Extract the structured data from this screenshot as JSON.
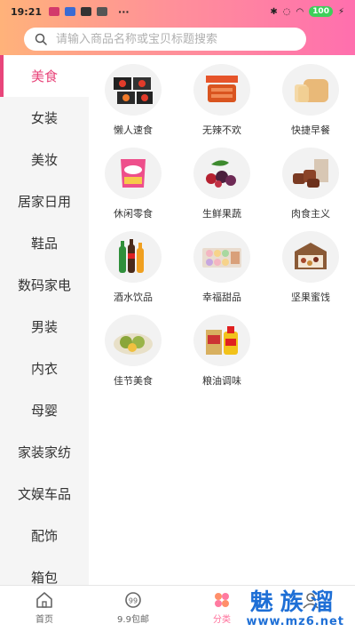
{
  "status_bar": {
    "time": "19:21",
    "dots": "···",
    "battery": "100"
  },
  "search": {
    "placeholder": "请输入商品名称或宝贝标题搜索"
  },
  "sidebar": {
    "items": [
      {
        "label": "美食",
        "active": true
      },
      {
        "label": "女装"
      },
      {
        "label": "美妆"
      },
      {
        "label": "居家日用"
      },
      {
        "label": "鞋品"
      },
      {
        "label": "数码家电"
      },
      {
        "label": "男装"
      },
      {
        "label": "内衣"
      },
      {
        "label": "母婴"
      },
      {
        "label": "家装家纺"
      },
      {
        "label": "文娱车品"
      },
      {
        "label": "配饰"
      },
      {
        "label": "箱包"
      }
    ]
  },
  "categories": [
    {
      "label": "懒人速食",
      "icon": "instant-noodles-icon"
    },
    {
      "label": "无辣不欢",
      "icon": "spicy-snack-icon"
    },
    {
      "label": "快捷早餐",
      "icon": "bread-icon"
    },
    {
      "label": "休闲零食",
      "icon": "snack-bag-icon"
    },
    {
      "label": "生鲜果蔬",
      "icon": "fruit-icon"
    },
    {
      "label": "肉食主义",
      "icon": "meat-icon"
    },
    {
      "label": "酒水饮品",
      "icon": "drinks-icon"
    },
    {
      "label": "幸福甜品",
      "icon": "macaron-icon"
    },
    {
      "label": "坚果蜜饯",
      "icon": "nuts-icon"
    },
    {
      "label": "佳节美食",
      "icon": "festival-food-icon"
    },
    {
      "label": "粮油调味",
      "icon": "cooking-oil-icon"
    }
  ],
  "bottom_nav": [
    {
      "label": "首页",
      "icon": "home-icon"
    },
    {
      "label": "9.9包邮",
      "icon": "nine-nine-icon"
    },
    {
      "label": "分类",
      "icon": "category-icon",
      "active": true
    },
    {
      "label": "",
      "icon": "user-icon"
    }
  ],
  "watermark": {
    "main": "魅族溜",
    "sub": "www.mz6.net"
  },
  "colors": {
    "accent": "#e8457a",
    "header_start": "#ffb27a",
    "header_end": "#ff6fae",
    "watermark": "#1e6fd6"
  }
}
